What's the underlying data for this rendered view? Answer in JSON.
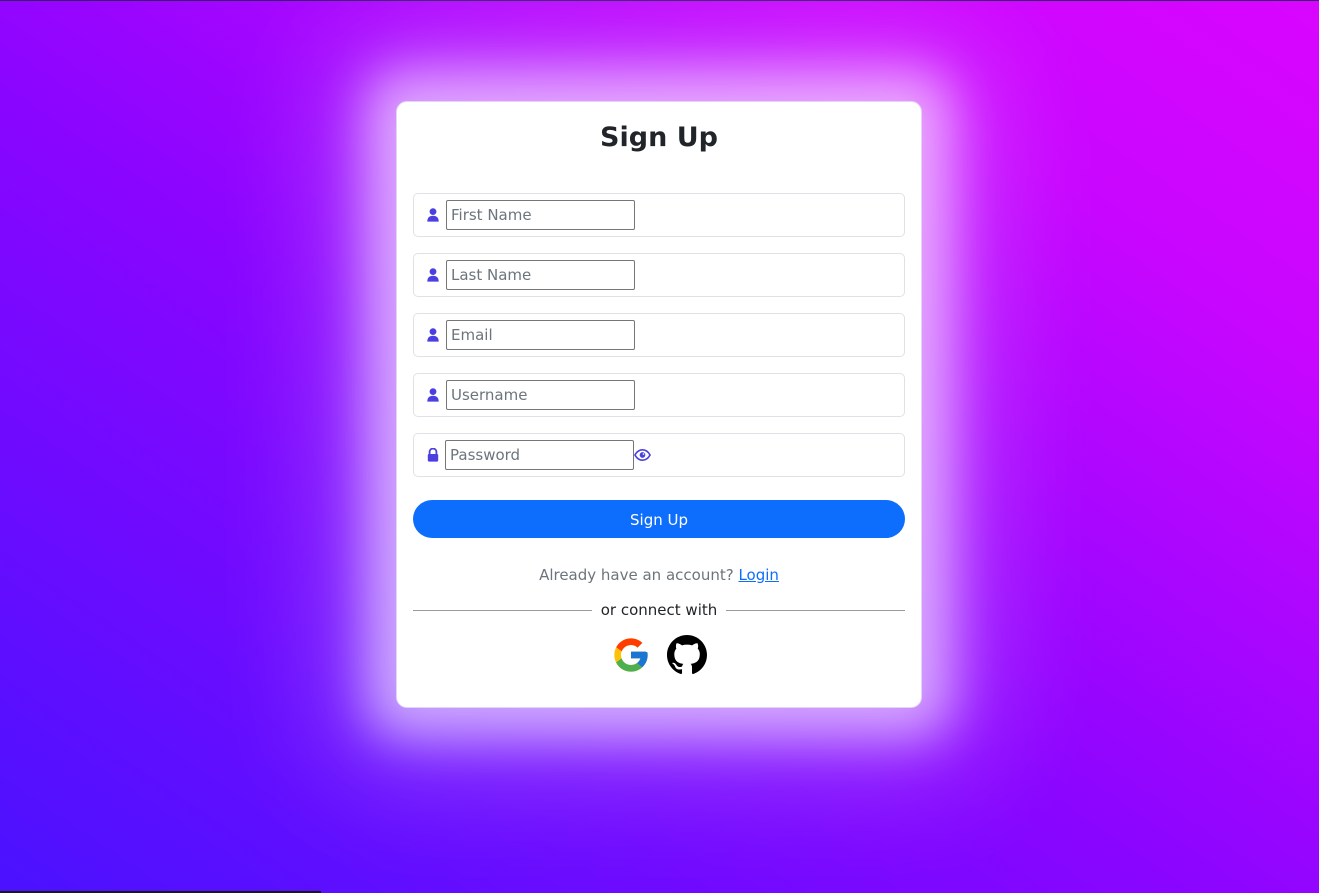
{
  "page": {
    "background_colors": [
      "#4a12ff",
      "#8a05ff",
      "#d905ff"
    ]
  },
  "form": {
    "title": "Sign Up",
    "fields": [
      {
        "placeholder": "First Name",
        "value": "",
        "icon": "user-icon"
      },
      {
        "placeholder": "Last Name",
        "value": "",
        "icon": "user-icon"
      },
      {
        "placeholder": "Email",
        "value": "",
        "icon": "user-icon"
      },
      {
        "placeholder": "Username",
        "value": "",
        "icon": "user-icon"
      },
      {
        "placeholder": "Password",
        "value": "",
        "icon": "lock-icon",
        "toggle_icon": "eye-icon"
      }
    ],
    "submit_label": "Sign Up",
    "accent_color": "#0d6efd",
    "icon_color": "#4b3fe0"
  },
  "footer": {
    "already_text": "Already have an account?",
    "login_link": "Login",
    "divider_text": "or connect with",
    "social": [
      {
        "name": "google-icon"
      },
      {
        "name": "github-icon"
      }
    ]
  }
}
